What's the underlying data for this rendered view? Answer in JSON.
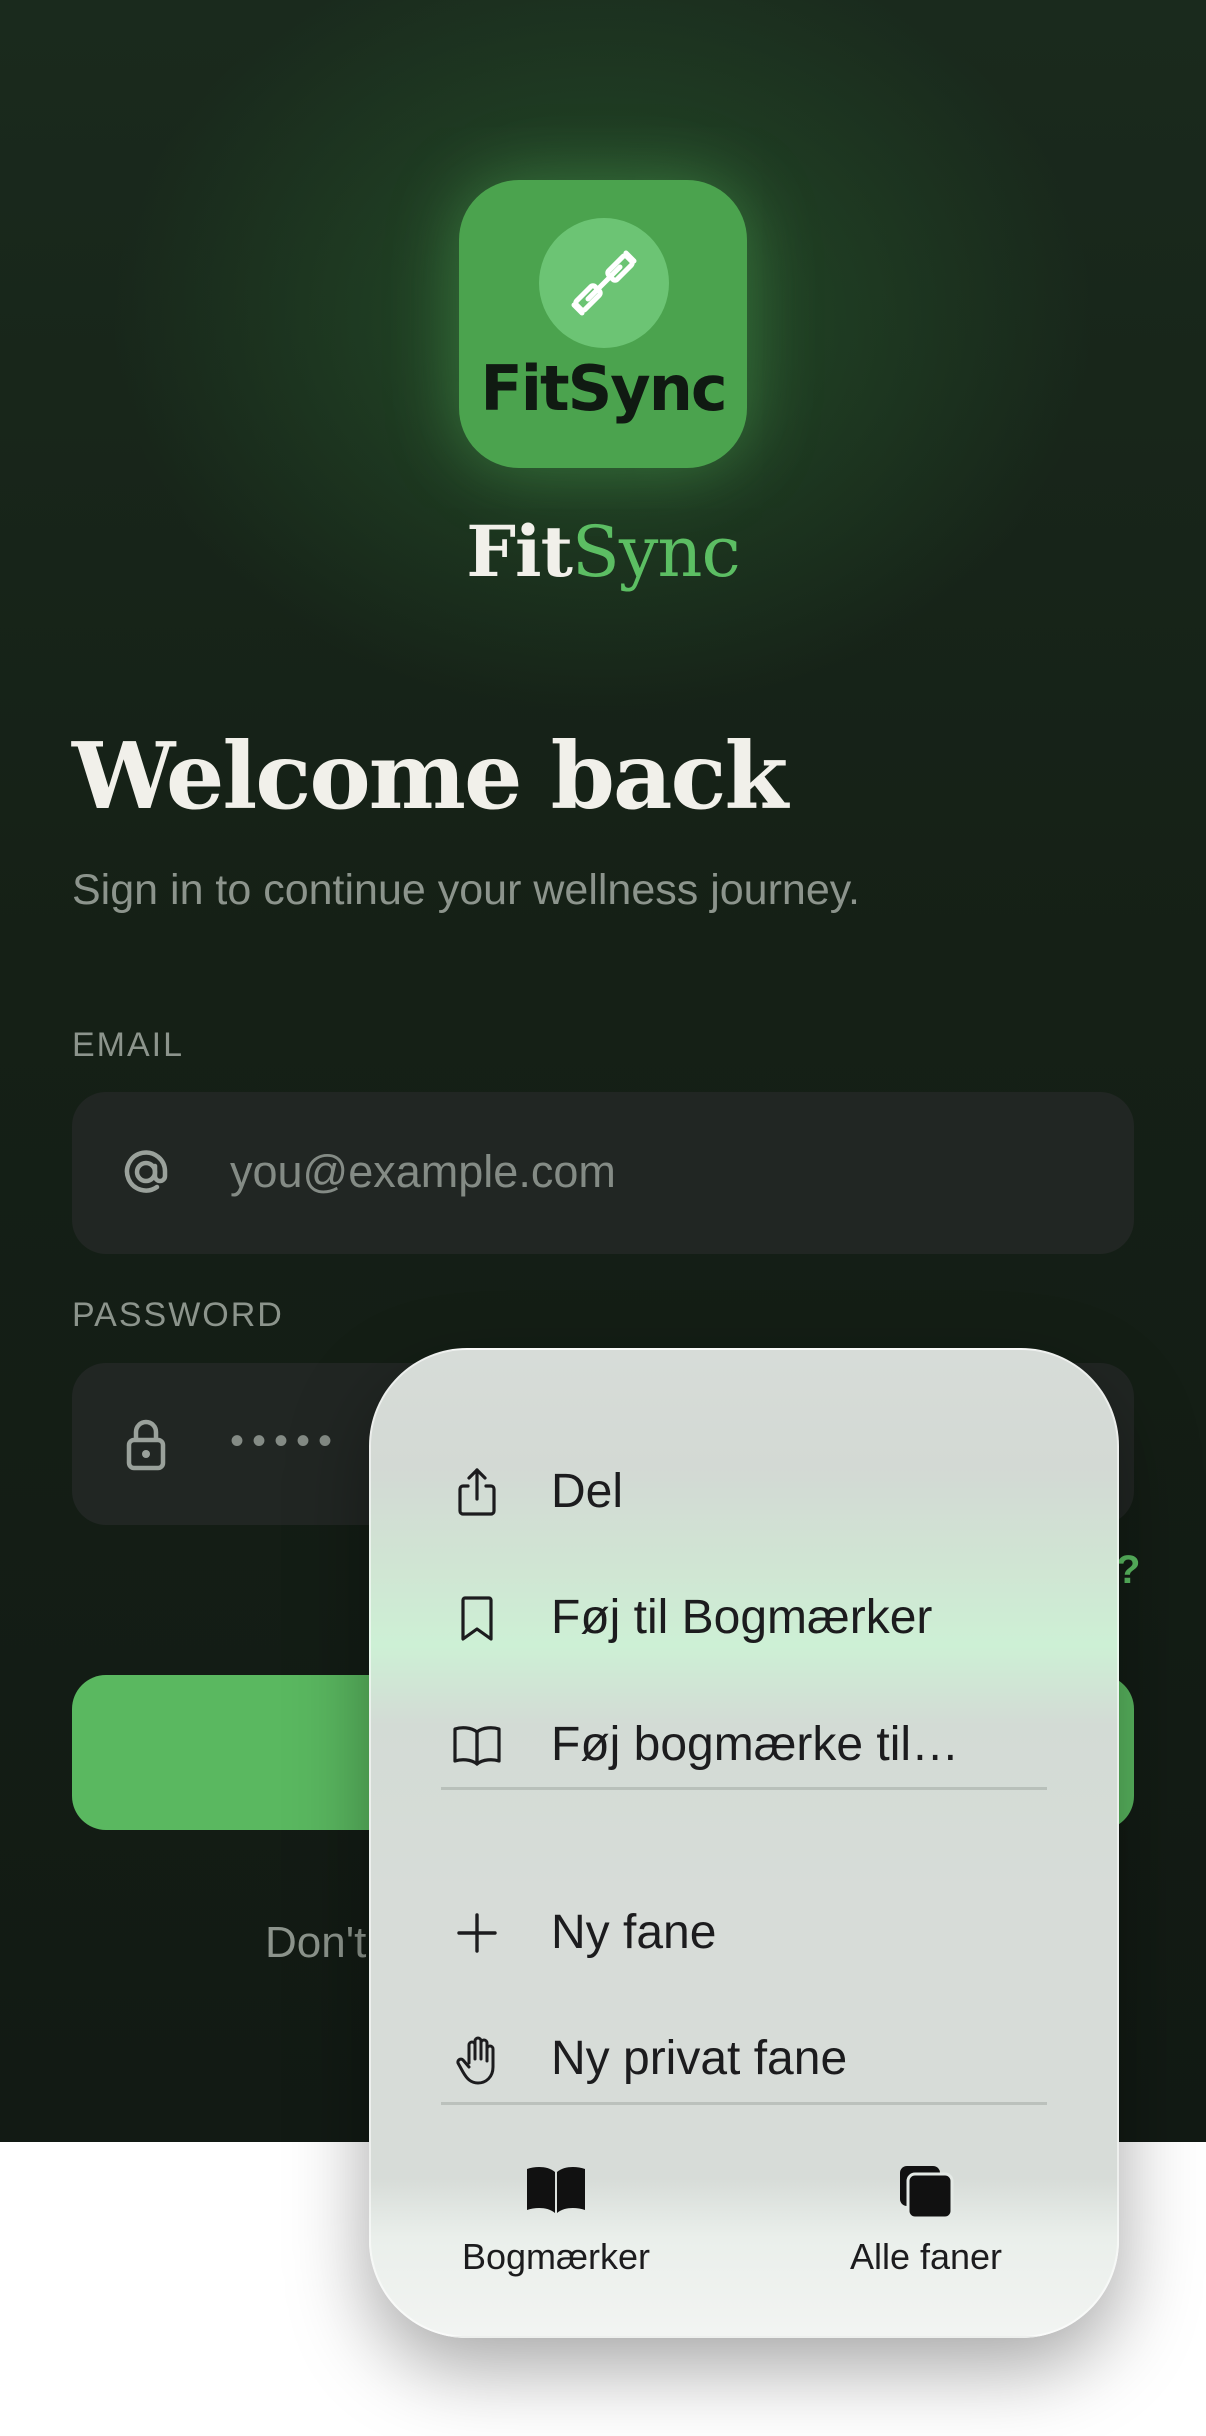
{
  "app_icon": {
    "text": "FitSync"
  },
  "brand": {
    "part1": "Fit",
    "part2": "Sync"
  },
  "headline": "Welcome back",
  "subtitle": "Sign in to continue your wellness journey.",
  "email": {
    "label": "EMAIL",
    "placeholder": "you@example.com",
    "icon": "at-icon"
  },
  "password": {
    "label": "PASSWORD",
    "value": "•••••",
    "icon": "lock-icon"
  },
  "forgot_fragment": "?",
  "signup_fragment": "Don't",
  "colors": {
    "accent": "#5cbe63",
    "button": "#5ab860",
    "background": "#152016",
    "field": "#212623"
  },
  "menu": {
    "items": [
      {
        "label": "Del",
        "icon": "share-icon"
      },
      {
        "label": "Føj til Bogmærker",
        "icon": "bookmark-icon"
      },
      {
        "label": "Føj bogmærke til…",
        "icon": "book-icon"
      },
      {
        "label": "Ny fane",
        "icon": "plus-icon"
      },
      {
        "label": "Ny privat fane",
        "icon": "hand-icon"
      }
    ],
    "bottom": [
      {
        "label": "Bogmærker",
        "icon": "book-filled-icon"
      },
      {
        "label": "Alle faner",
        "icon": "tabs-icon"
      }
    ]
  }
}
